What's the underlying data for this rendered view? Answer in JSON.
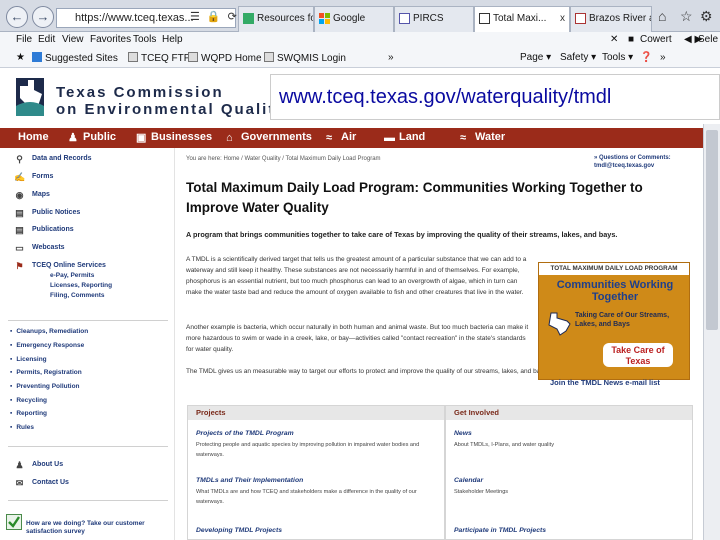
{
  "browser": {
    "address": "https://www.tceq.texas...",
    "tabs": [
      {
        "label": "Resources for ..."
      },
      {
        "label": "Google"
      },
      {
        "label": "PIRCS"
      },
      {
        "label": "Total Maxi..."
      },
      {
        "label": "Brazos River a..."
      }
    ],
    "tab_close": "x",
    "menu": [
      "File",
      "Edit",
      "View",
      "Favorites",
      "Tools",
      "Help"
    ],
    "favorites": [
      "Suggested Sites",
      "TCEQ FTPS",
      "WQPD Home",
      "SWQMIS Login"
    ],
    "find_user": "Cowert",
    "toolbar_right": [
      "Page",
      "Safety",
      "Tools"
    ],
    "right_cut": "Sele"
  },
  "site": {
    "logo_line1": "Texas Commission",
    "logo_line2": "on Environmental Quality",
    "url_overlay": "www.tceq.texas.gov/waterquality/tmdl",
    "nav": [
      "Home",
      "Public",
      "Businesses",
      "Governments",
      "Air",
      "Land",
      "Water"
    ],
    "colors": {
      "nav_bg": "#9b2b1a",
      "link": "#1f3a7a",
      "promo": "#cf8a18"
    }
  },
  "sidebar": {
    "primary": [
      {
        "label": "Data and Records",
        "icon": "search-icon"
      },
      {
        "label": "Forms",
        "icon": "form-icon"
      },
      {
        "label": "Maps",
        "icon": "globe-icon"
      },
      {
        "label": "Public Notices",
        "icon": "notice-icon"
      },
      {
        "label": "Publications",
        "icon": "book-icon"
      },
      {
        "label": "Webcasts",
        "icon": "monitor-icon"
      },
      {
        "label": "TCEQ Online Services",
        "icon": "flag-icon"
      }
    ],
    "online_services_sub": "e-Pay, Permits\nLicenses, Reporting\nFiling, Comments",
    "secondary": [
      "Cleanups, Remediation",
      "Emergency Response",
      "Licensing",
      "Permits, Registration",
      "Preventing Pollution",
      "Recycling",
      "Reporting",
      "Rules"
    ],
    "contact": [
      {
        "label": "About Us",
        "icon": "people-icon"
      },
      {
        "label": "Contact Us",
        "icon": "mail-icon"
      }
    ],
    "survey": "How are we doing? Take our customer satisfaction survey"
  },
  "main": {
    "breadcrumb": "You are here: Home / Water Quality / Total Maximum Daily Load Program",
    "questions": "» Questions or Comments:\ntmdl@tceq.texas.gov",
    "title": "Total Maximum Daily Load Program: Communities Working Together to Improve Water Quality",
    "lede": "A program that brings communities together to take care of Texas by improving the quality of their streams, lakes, and bays.",
    "para1": "A TMDL is a scientifically derived target that tells us the greatest amount of a particular substance that we can add to a waterway and still keep it healthy. These substances are not necessarily harmful in and of themselves. For example, phosphorus is an essential nutrient, but too much phosphorus can lead to an overgrowth of algae, which in turn can make the water taste bad and reduce the amount of oxygen available to fish and other creatures that live in the water.",
    "para2": "Another example is bacteria, which occur naturally in both human and animal waste. But too much bacteria can make it more hazardous to swim or wade in a creek, lake, or bay—activities called \"contact recreation\" in the state's standards for water quality.",
    "para3": "The TMDL gives us an measurable way to target our efforts to protect and improve the quality of our streams, lakes, and bays.",
    "promo_top": "TOTAL MAXIMUM DAILY LOAD PROGRAM",
    "promo_heading": "Communities Working Together",
    "promo_sub": "Taking Care of Our Streams, Lakes, and Bays",
    "promo_logo": "Take Care of Texas",
    "join": "Join the TMDL News e-mail list",
    "projects": {
      "heading": "Projects",
      "items": [
        {
          "title": "Projects of the TMDL Program",
          "desc": "Protecting people and aquatic species by improving pollution in impaired water bodies and waterways."
        },
        {
          "title": "TMDLs and Their Implementation",
          "desc": "What TMDLs are and how TCEQ and stakeholders make a difference in the quality of our waterways."
        },
        {
          "title": "Developing TMDL Projects",
          "desc": ""
        }
      ]
    },
    "involved": {
      "heading": "Get Involved",
      "items": [
        {
          "title": "News",
          "desc": "About TMDLs, I-Plans, and water quality"
        },
        {
          "title": "Calendar",
          "desc": "Stakeholder Meetings"
        },
        {
          "title": "Participate in TMDL Projects",
          "desc": ""
        }
      ]
    }
  }
}
